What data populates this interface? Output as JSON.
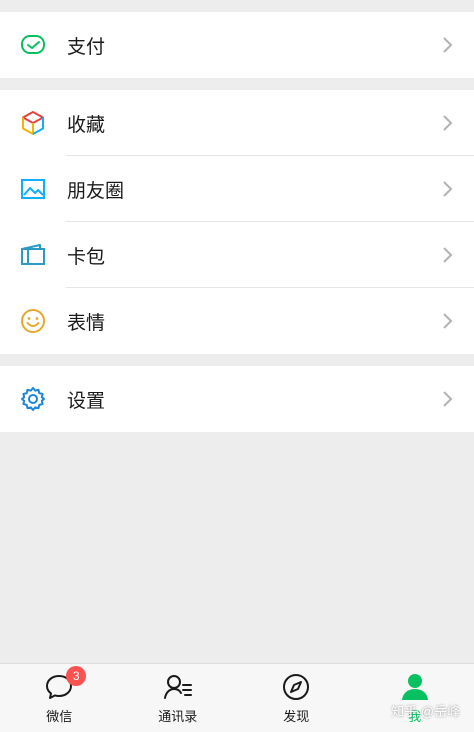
{
  "menu": {
    "pay": "支付",
    "favorites": "收藏",
    "moments": "朋友圈",
    "cards": "卡包",
    "stickers": "表情",
    "settings": "设置"
  },
  "tabs": [
    {
      "label": "微信",
      "badge": "3"
    },
    {
      "label": "通讯录"
    },
    {
      "label": "发现"
    },
    {
      "label": "我"
    }
  ],
  "watermark": "知乎 @岳峰",
  "colors": {
    "accent": "#07c160",
    "badge": "#fa5151"
  }
}
